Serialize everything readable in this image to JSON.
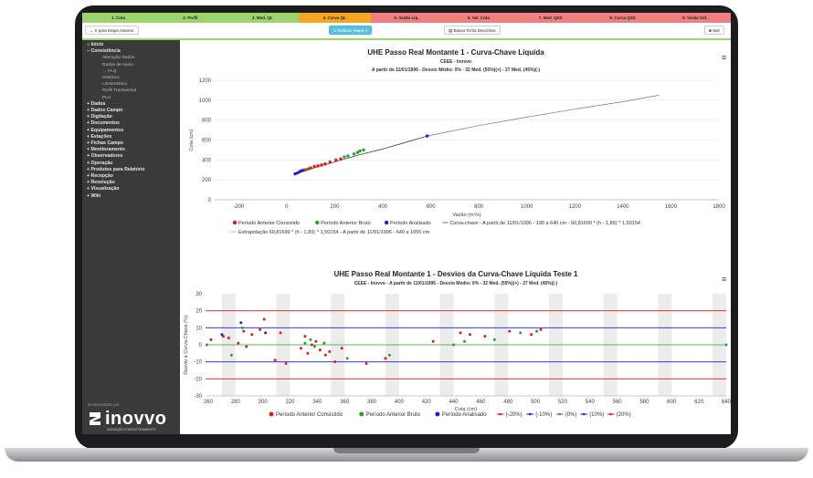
{
  "steps": [
    {
      "label": "1. Cota",
      "color": "#9ed46e"
    },
    {
      "label": "2. Perfil",
      "color": "#9ed46e"
    },
    {
      "label": "3. Med. QL",
      "color": "#9ed46e"
    },
    {
      "label": "4. Curva QL",
      "color": "#f5a623"
    },
    {
      "label": "5. Vazão Liq.",
      "color": "#f08080"
    },
    {
      "label": "6. Val. Cota",
      "color": "#f08080"
    },
    {
      "label": "7. Med. QSS",
      "color": "#f08080"
    },
    {
      "label": "8. Curva QSS",
      "color": "#f08080"
    },
    {
      "label": "9. Vazão Sól.",
      "color": "#f08080"
    }
  ],
  "toolbar": {
    "back_label": "← Ir para Etapa Anterior",
    "redo_label": "↻ Refazer etapa 4",
    "download_label": "▤ Baixar Ficha Descritiva",
    "exit_label": "■ Sair"
  },
  "sidebar": {
    "items": [
      {
        "label": "⌂ Início",
        "level": "top"
      },
      {
        "label": "− Consistência",
        "level": "top"
      },
      {
        "label": "Alteração Dados",
        "level": "sub"
      },
      {
        "label": "Dados de Apoio",
        "level": "sub"
      },
      {
        "label": "→ FLQ",
        "level": "sub",
        "active": true
      },
      {
        "label": "Histórico",
        "level": "sub"
      },
      {
        "label": "Limnimétrico",
        "level": "sub"
      },
      {
        "label": "Perfil Transversal",
        "level": "sub"
      },
      {
        "label": "PLU",
        "level": "sub"
      },
      {
        "label": "+ Dados",
        "level": "top"
      },
      {
        "label": "+ Dados Campo",
        "level": "top"
      },
      {
        "label": "+ Digitação",
        "level": "top"
      },
      {
        "label": "+ Documentos",
        "level": "top"
      },
      {
        "label": "+ Equipamentos",
        "level": "top"
      },
      {
        "label": "+ Estações",
        "level": "top"
      },
      {
        "label": "+ Fichas Campo",
        "level": "top"
      },
      {
        "label": "+ Monitoramento",
        "level": "top"
      },
      {
        "label": "+ Observadores",
        "level": "top"
      },
      {
        "label": "+ Operação",
        "level": "top"
      },
      {
        "label": "+ Produtos para Relatório",
        "level": "top"
      },
      {
        "label": "+ Recepção",
        "level": "top"
      },
      {
        "label": "+ Resolução",
        "level": "top"
      },
      {
        "label": "+ Visualização",
        "level": "top"
      },
      {
        "label": "+ Wiki",
        "level": "top"
      }
    ],
    "developed_by": "Desenvolvido por",
    "logo_text": "inovvo",
    "logo_sub": "INOVAÇÃO E MONITORAMENTO"
  },
  "chart_data": [
    {
      "type": "scatter",
      "title": "UHE Passo Real Montante 1 - Curva-Chave Líquida",
      "subtitle": "CEEE - Inovvo",
      "subtitle2": "A partir de 11/01/1996 - Desvio Médio: 0% - 32 Med. (55%)(+) - 27 Med. (45%)(-)",
      "xlabel": "Vazão (m³/s)",
      "ylabel": "Cota (cm)",
      "xlim": [
        -300,
        1800
      ],
      "ylim": [
        0,
        1200
      ],
      "xticks": [
        -200,
        0,
        200,
        400,
        600,
        800,
        1000,
        1200,
        1400,
        1600,
        1800
      ],
      "yticks": [
        0,
        200,
        400,
        600,
        800,
        1000,
        1200
      ],
      "series": [
        {
          "name": "Período Anterior Consistido",
          "color": "#e31a1c",
          "points": [
            [
              75,
              300
            ],
            [
              90,
              310
            ],
            [
              100,
              320
            ],
            [
              115,
              335
            ],
            [
              130,
              340
            ],
            [
              145,
              350
            ],
            [
              160,
              360
            ],
            [
              180,
              380
            ],
            [
              205,
              400
            ],
            [
              225,
              410
            ]
          ]
        },
        {
          "name": "Período Anterior Bruto",
          "color": "#2ca02c",
          "points": [
            [
              240,
              430
            ],
            [
              255,
              440
            ],
            [
              280,
              460
            ],
            [
              295,
              475
            ],
            [
              305,
              490
            ],
            [
              320,
              500
            ],
            [
              60,
              290
            ],
            [
              85,
              305
            ]
          ]
        },
        {
          "name": "Período Analisado",
          "color": "#1f1fd6",
          "points": [
            [
              35,
              260
            ],
            [
              45,
              270
            ],
            [
              55,
              285
            ],
            [
              65,
              295
            ],
            [
              585,
              640
            ]
          ]
        }
      ],
      "curve": {
        "name": "Curva-chave - A partir de 11/01/1996 - 190 a 640 cm - 60,81699 * (h - 1,89) ^ 1,50154",
        "color": "#444444",
        "points": [
          [
            30,
            250
          ],
          [
            100,
            310
          ],
          [
            200,
            380
          ],
          [
            300,
            450
          ],
          [
            400,
            510
          ],
          [
            500,
            580
          ],
          [
            585,
            640
          ]
        ]
      },
      "extrapolation": {
        "name": "Extrapolação 60,81699 * (h - 1,89) ^ 1,50154 - A partir de 11/01/1996 - 640 a 1055 cm",
        "color": "#777777",
        "points": [
          [
            585,
            640
          ],
          [
            800,
            745
          ],
          [
            1000,
            830
          ],
          [
            1200,
            910
          ],
          [
            1400,
            985
          ],
          [
            1550,
            1050
          ]
        ]
      }
    },
    {
      "type": "scatter",
      "title": "UHE Passo Real Montante 1 - Desvios da Curva-Chave Líquida Teste 1",
      "subtitle": "CEEE - Inovvo - A partir de 11/01/1996 - Desvio Médio: 0% - 32 Med. (55%)(+) - 27 Med. (45%)(-)",
      "xlabel": "Cota (cm)",
      "ylabel": "Desvio à Curva-Chave (%)",
      "xlim": [
        258,
        640
      ],
      "ylim": [
        -30,
        30
      ],
      "xticks": [
        260,
        280,
        300,
        320,
        340,
        360,
        380,
        400,
        420,
        440,
        460,
        480,
        500,
        520,
        540,
        560,
        580,
        600,
        620,
        640
      ],
      "yticks": [
        -30,
        -20,
        -10,
        0,
        10,
        20,
        30
      ],
      "series": [
        {
          "name": "Período Anterior Consistido",
          "color": "#e31a1c",
          "points": [
            [
              262,
              3
            ],
            [
              271,
              5
            ],
            [
              275,
              4
            ],
            [
              282,
              1
            ],
            [
              286,
              8
            ],
            [
              288,
              -1
            ],
            [
              292,
              6
            ],
            [
              298,
              9
            ],
            [
              301,
              15
            ],
            [
              309,
              -9
            ],
            [
              313,
              7
            ],
            [
              317,
              -11
            ],
            [
              328,
              -2
            ],
            [
              331,
              5
            ],
            [
              333,
              -5
            ],
            [
              336,
              0
            ],
            [
              339,
              2
            ],
            [
              342,
              -3
            ],
            [
              346,
              -6
            ],
            [
              349,
              -4
            ],
            [
              353,
              -10
            ],
            [
              358,
              -2
            ],
            [
              376,
              -11
            ],
            [
              390,
              -8
            ],
            [
              425,
              2
            ],
            [
              445,
              7
            ],
            [
              452,
              6
            ],
            [
              463,
              5
            ],
            [
              481,
              8
            ],
            [
              497,
              6
            ],
            [
              504,
              9
            ]
          ]
        },
        {
          "name": "Período Anterior Bruto",
          "color": "#2ca02c",
          "points": [
            [
              259,
              0
            ],
            [
              277,
              -6
            ],
            [
              285,
              10
            ],
            [
              331,
              1
            ],
            [
              335,
              3
            ],
            [
              338,
              -1
            ],
            [
              345,
              1
            ],
            [
              362,
              -8
            ],
            [
              393,
              -6
            ],
            [
              440,
              0
            ],
            [
              448,
              2
            ],
            [
              470,
              3
            ],
            [
              489,
              7
            ],
            [
              501,
              8
            ],
            [
              640,
              0
            ]
          ]
        },
        {
          "name": "Período Analisado",
          "color": "#1f1fd6",
          "points": [
            [
              270,
              6
            ],
            [
              284,
              13
            ],
            [
              302,
              7
            ]
          ]
        }
      ],
      "reference_lines": [
        {
          "name": "(-20%)",
          "value": -20,
          "color": "#e31a1c"
        },
        {
          "name": "(-10%)",
          "value": -10,
          "color": "#1f1fd6"
        },
        {
          "name": "(0%)",
          "value": 0,
          "color": "#2ca02c"
        },
        {
          "name": "(10%)",
          "value": 10,
          "color": "#1f1fd6"
        },
        {
          "name": "(20%)",
          "value": 20,
          "color": "#e31a1c"
        }
      ]
    }
  ]
}
